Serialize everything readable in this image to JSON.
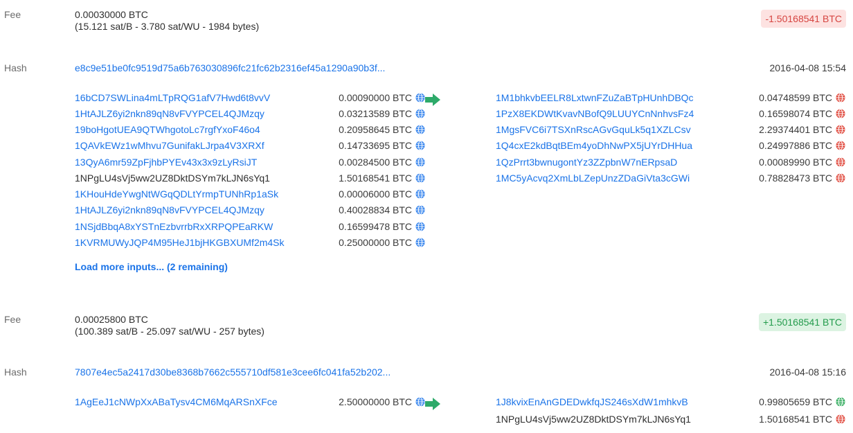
{
  "labels": {
    "fee": "Fee",
    "hash": "Hash"
  },
  "colors": {
    "link": "#1a73e8",
    "negative": "#d64541",
    "positive": "#239b4c",
    "arrow": "#2eaa6a",
    "spent": "#e0463a",
    "unspent": "#2eaa5a",
    "input_globe": "#2f80ed"
  },
  "tx1": {
    "fee_value": "0.00030000 BTC",
    "fee_detail": "(15.121 sat/B - 3.780 sat/WU - 1984 bytes)",
    "balance_change": "-1.50168541 BTC",
    "hash": "e8c9e51be0fc9519d75a6b763030896fc21fc62b2316ef45a1290a90b3f...",
    "date": "2016-04-08 15:54",
    "inputs": [
      {
        "address": "16bCD7SWLina4mLTpRQG1afV7Hwd6t8vvV",
        "amount": "0.00090000 BTC"
      },
      {
        "address": "1HtAJLZ6yi2nkn89qN8vFVYPCEL4QJMzqy",
        "amount": "0.03213589 BTC"
      },
      {
        "address": "19boHgotUEA9QTWhgotoLc7rgfYxoF46o4",
        "amount": "0.20958645 BTC"
      },
      {
        "address": "1QAVkEWz1wMhvu7GunifakLJrpa4V3XRXf",
        "amount": "0.14733695 BTC"
      },
      {
        "address": "13QyA6mr59ZpFjhbPYEv43x3x9zLyRsiJT",
        "amount": "0.00284500 BTC"
      },
      {
        "address": "1NPgLU4sVj5ww2UZ8DktDSYm7kLJN6sYq1",
        "amount": "1.50168541 BTC"
      },
      {
        "address": "1KHouHdeYwgNtWGqQDLtYrmpTUNhRp1aSk",
        "amount": "0.00006000 BTC"
      },
      {
        "address": "1HtAJLZ6yi2nkn89qN8vFVYPCEL4QJMzqy",
        "amount": "0.40028834 BTC"
      },
      {
        "address": "1NSjdBbqA8xYSTnEzbvrrbRxXRPQPEaRKW",
        "amount": "0.16599478 BTC"
      },
      {
        "address": "1KVRMUWyJQP4M95HeJ1bjHKGBXUMf2m4Sk",
        "amount": "0.25000000 BTC"
      }
    ],
    "load_more": "Load more inputs... (2 remaining)",
    "outputs": [
      {
        "address": "1M1bhkvbEELR8LxtwnFZuZaBTpHUnhDBQc",
        "amount": "0.04748599 BTC"
      },
      {
        "address": "1PzX8EKDWtKvavNBofQ9LUUYCnNnhvsFz4",
        "amount": "0.16598074 BTC"
      },
      {
        "address": "1MgsFVC6i7TSXnRscAGvGquLk5q1XZLCsv",
        "amount": "2.29374401 BTC"
      },
      {
        "address": "1Q4cxE2kdBqtBEm4yoDhNwPX5jUYrDHHua",
        "amount": "0.24997886 BTC"
      },
      {
        "address": "1QzPrrt3bwnugontYz3ZZpbnW7nERpsaD",
        "amount": "0.00089990 BTC"
      },
      {
        "address": "1MC5yAcvq2XmLbLZepUnzZDaGiVta3cGWi",
        "amount": "0.78828473 BTC"
      }
    ]
  },
  "tx2": {
    "fee_value": "0.00025800 BTC",
    "fee_detail": "(100.389 sat/B - 25.097 sat/WU - 257 bytes)",
    "balance_change": "+1.50168541 BTC",
    "hash": "7807e4ec5a2417d30be8368b7662c555710df581e3cee6fc041fa52b202...",
    "date": "2016-04-08 15:16",
    "inputs": [
      {
        "address": "1AgEeJ1cNWpXxABaTysv4CM6MqARSnXFce",
        "amount": "2.50000000 BTC"
      }
    ],
    "outputs": [
      {
        "address": "1J8kvixEnAnGDEDwkfqJS246sXdW1mhkvB",
        "amount": "0.99805659 BTC"
      },
      {
        "address": "1NPgLU4sVj5ww2UZ8DktDSYm7kLJN6sYq1",
        "amount": "1.50168541 BTC"
      }
    ]
  }
}
